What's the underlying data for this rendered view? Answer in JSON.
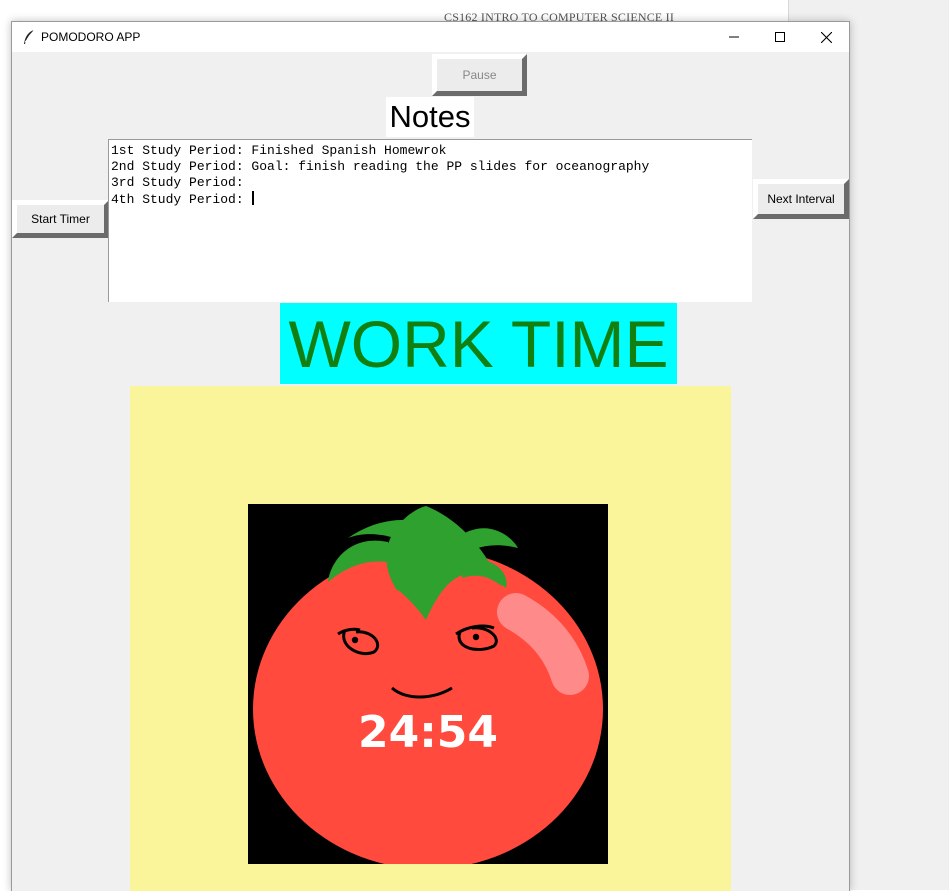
{
  "background": {
    "document_title": "CS162 INTRO TO COMPUTER SCIENCE II"
  },
  "window": {
    "title": "POMODORO APP",
    "icon": "feather-icon"
  },
  "controls": {
    "pause_label": "Pause",
    "start_label": "Start Timer",
    "next_label": "Next Interval"
  },
  "notes": {
    "label": "Notes",
    "lines": [
      "1st Study Period: Finished Spanish Homewrok",
      "2nd Study Period: Goal: finish reading the PP slides for oceanography",
      "3rd Study Period:",
      "4th Study Period: "
    ]
  },
  "mode": {
    "label": "WORK TIME",
    "background": "#00ffff",
    "color": "#118011"
  },
  "timer": {
    "value": "24:54"
  },
  "colors": {
    "canvas_bg": "#faf59b",
    "tomato": "#ff4a3d",
    "leaf": "#2ea12e",
    "shine": "#ff8a8a"
  }
}
